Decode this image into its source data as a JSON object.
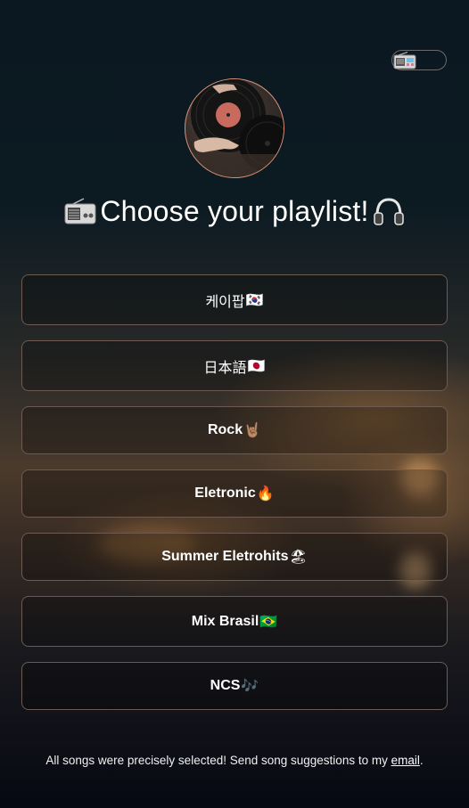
{
  "header": {
    "title": "Choose your playlist!",
    "title_left_icon": "radio-icon",
    "title_right_icon": "headphones-icon"
  },
  "theme_toggle": {
    "icon": "radio-icon"
  },
  "avatar": {
    "icon": "vinyl-record-image"
  },
  "playlists": [
    {
      "label": "케이팝",
      "emoji": "🇰🇷",
      "bold": false
    },
    {
      "label": "日本語",
      "emoji": "🇯🇵",
      "bold": false
    },
    {
      "label": "Rock",
      "emoji": "🤘🏽",
      "bold": true
    },
    {
      "label": "Eletronic",
      "emoji": "🔥",
      "bold": true
    },
    {
      "label": "Summer Eletrohits",
      "emoji": "🏖",
      "bold": true
    },
    {
      "label": "Mix Brasil",
      "emoji": "🇧🇷",
      "bold": true
    },
    {
      "label": "NCS",
      "emoji": "🎶",
      "bold": true
    }
  ],
  "footer": {
    "text": "All songs were precisely selected! Send song suggestions to my ",
    "link": "email",
    "suffix": "."
  },
  "colors": {
    "border": "#6e5a52",
    "avatar_border": "#d9927c"
  }
}
